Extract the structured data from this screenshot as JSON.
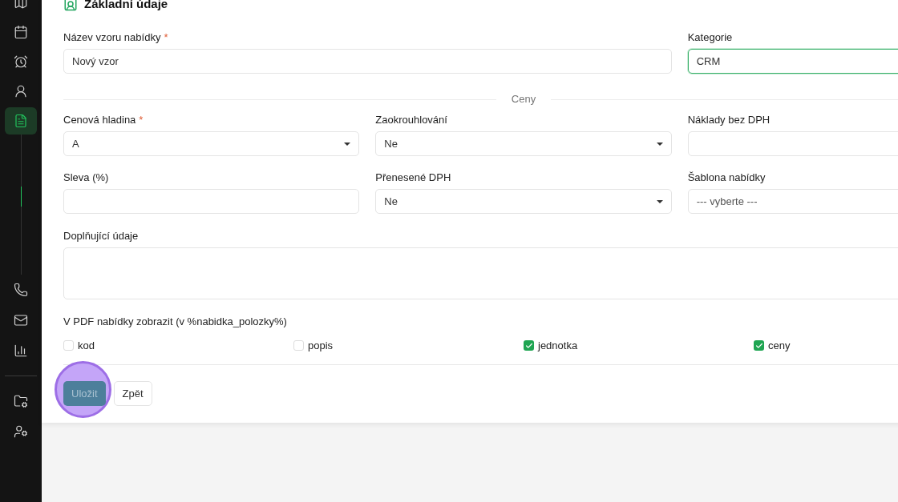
{
  "sidebar": {
    "items": [
      {
        "selected": false
      },
      {
        "selected": false
      },
      {
        "selected": false
      },
      {
        "selected": false
      },
      {
        "selected": true
      }
    ]
  },
  "section": {
    "title": "Základní údaje"
  },
  "top_fields": [
    {
      "kind": "text",
      "label": "Název vzoru nabídky",
      "required_mark": "*",
      "value": "Nový vzor",
      "focused": false
    },
    {
      "kind": "text",
      "label": "Kategorie",
      "value": "CRM",
      "focused": true
    }
  ],
  "divider": {
    "label": "Ceny"
  },
  "price_fields": [
    {
      "kind": "select",
      "label": "Cenová hladina",
      "required_mark": "*",
      "value": "A"
    },
    {
      "kind": "select",
      "label": "Zaokrouhlování",
      "value": "Ne"
    },
    {
      "kind": "text",
      "label": "Náklady bez DPH"
    },
    {
      "kind": "text",
      "label": "Sleva (%)"
    },
    {
      "kind": "select",
      "label": "Přenesené DPH",
      "value": "Ne"
    },
    {
      "kind": "text",
      "label": "Šablona nabídky",
      "placeholder": "--- vyberte ---"
    }
  ],
  "notes": {
    "label": "Doplňující údaje"
  },
  "pdf": {
    "label": "V PDF nabídky zobrazit (v %nabidka_polozky%)",
    "options": [
      {
        "label": "kod",
        "checked": false
      },
      {
        "label": "popis",
        "checked": false
      },
      {
        "label": "jednotka",
        "checked": true
      },
      {
        "label": "ceny",
        "checked": true
      }
    ]
  },
  "buttons": [
    {
      "kind": "primary",
      "label": "Uložit",
      "highlighted": true
    },
    {
      "kind": "secondary",
      "label": "Zpět",
      "highlighted": false
    }
  ]
}
